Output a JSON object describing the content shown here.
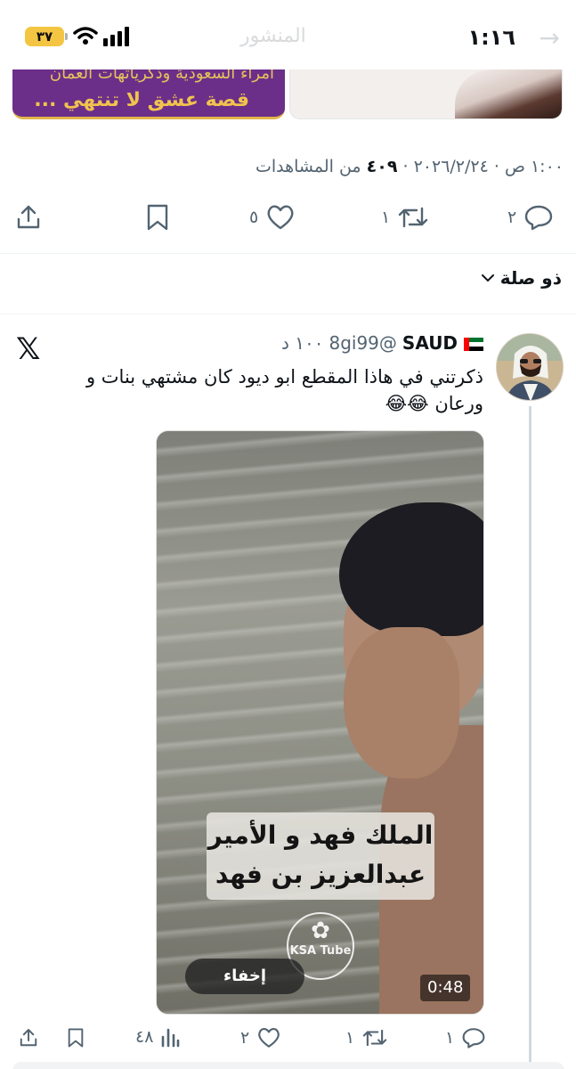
{
  "status_bar": {
    "time": "١:١٦",
    "battery": "٣٧",
    "header_title": "المنشور"
  },
  "top_cards": {
    "left_line1": "أمراء السعودية وذكرياتهات العمان",
    "left_line2": "قصة عشق لا تنتهي ..."
  },
  "main_post": {
    "meta_time": "١:٠٠ ص · ٢٠٢٦/٢/٢٤",
    "meta_views_count": "٤٠٩",
    "meta_views_label": "من المشاهدات",
    "replies": "٢",
    "reposts": "١",
    "likes": "٥"
  },
  "thread_label": "ذو صلة",
  "tweet": {
    "name": "SAUD",
    "handle": "@8gi99",
    "time": "١٠٠ د",
    "text": "ذكرتني في هاذا المقطع ابو ديود كان مشتهي بنات و ورعان 😂😂",
    "media": {
      "caption_line1": "الملك فهد و الأمير",
      "caption_line2": "عبدالعزيز بن فهد",
      "watermark": "KSA Tube",
      "hide_label": "إخفاء",
      "duration": "0:48"
    },
    "replies": "١",
    "reposts": "١",
    "likes": "٢",
    "views": "٤٨"
  },
  "colors": {
    "text_primary": "#0f1419",
    "text_secondary": "#536471",
    "battery_yellow": "#f4c542"
  },
  "icons": [
    "back-arrow-icon",
    "wifi-icon",
    "signal-icon",
    "share-icon",
    "bookmark-icon",
    "heart-icon",
    "repost-icon",
    "reply-icon",
    "views-icon",
    "chevron-down-icon",
    "x-logo-icon"
  ]
}
